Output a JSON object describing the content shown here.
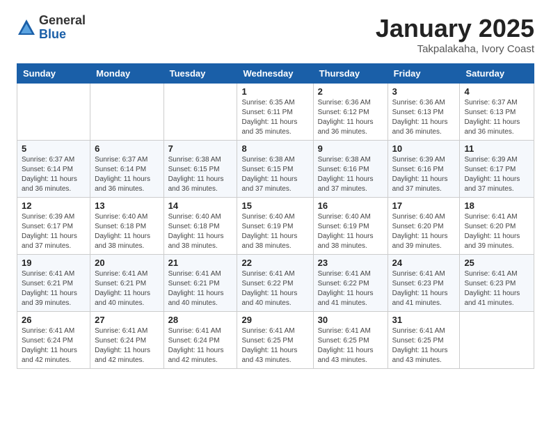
{
  "logo": {
    "general": "General",
    "blue": "Blue"
  },
  "title": "January 2025",
  "location": "Takpalakaha, Ivory Coast",
  "weekdays": [
    "Sunday",
    "Monday",
    "Tuesday",
    "Wednesday",
    "Thursday",
    "Friday",
    "Saturday"
  ],
  "weeks": [
    [
      {
        "day": "",
        "info": ""
      },
      {
        "day": "",
        "info": ""
      },
      {
        "day": "",
        "info": ""
      },
      {
        "day": "1",
        "info": "Sunrise: 6:35 AM\nSunset: 6:11 PM\nDaylight: 11 hours\nand 35 minutes."
      },
      {
        "day": "2",
        "info": "Sunrise: 6:36 AM\nSunset: 6:12 PM\nDaylight: 11 hours\nand 36 minutes."
      },
      {
        "day": "3",
        "info": "Sunrise: 6:36 AM\nSunset: 6:13 PM\nDaylight: 11 hours\nand 36 minutes."
      },
      {
        "day": "4",
        "info": "Sunrise: 6:37 AM\nSunset: 6:13 PM\nDaylight: 11 hours\nand 36 minutes."
      }
    ],
    [
      {
        "day": "5",
        "info": "Sunrise: 6:37 AM\nSunset: 6:14 PM\nDaylight: 11 hours\nand 36 minutes."
      },
      {
        "day": "6",
        "info": "Sunrise: 6:37 AM\nSunset: 6:14 PM\nDaylight: 11 hours\nand 36 minutes."
      },
      {
        "day": "7",
        "info": "Sunrise: 6:38 AM\nSunset: 6:15 PM\nDaylight: 11 hours\nand 36 minutes."
      },
      {
        "day": "8",
        "info": "Sunrise: 6:38 AM\nSunset: 6:15 PM\nDaylight: 11 hours\nand 37 minutes."
      },
      {
        "day": "9",
        "info": "Sunrise: 6:38 AM\nSunset: 6:16 PM\nDaylight: 11 hours\nand 37 minutes."
      },
      {
        "day": "10",
        "info": "Sunrise: 6:39 AM\nSunset: 6:16 PM\nDaylight: 11 hours\nand 37 minutes."
      },
      {
        "day": "11",
        "info": "Sunrise: 6:39 AM\nSunset: 6:17 PM\nDaylight: 11 hours\nand 37 minutes."
      }
    ],
    [
      {
        "day": "12",
        "info": "Sunrise: 6:39 AM\nSunset: 6:17 PM\nDaylight: 11 hours\nand 37 minutes."
      },
      {
        "day": "13",
        "info": "Sunrise: 6:40 AM\nSunset: 6:18 PM\nDaylight: 11 hours\nand 38 minutes."
      },
      {
        "day": "14",
        "info": "Sunrise: 6:40 AM\nSunset: 6:18 PM\nDaylight: 11 hours\nand 38 minutes."
      },
      {
        "day": "15",
        "info": "Sunrise: 6:40 AM\nSunset: 6:19 PM\nDaylight: 11 hours\nand 38 minutes."
      },
      {
        "day": "16",
        "info": "Sunrise: 6:40 AM\nSunset: 6:19 PM\nDaylight: 11 hours\nand 38 minutes."
      },
      {
        "day": "17",
        "info": "Sunrise: 6:40 AM\nSunset: 6:20 PM\nDaylight: 11 hours\nand 39 minutes."
      },
      {
        "day": "18",
        "info": "Sunrise: 6:41 AM\nSunset: 6:20 PM\nDaylight: 11 hours\nand 39 minutes."
      }
    ],
    [
      {
        "day": "19",
        "info": "Sunrise: 6:41 AM\nSunset: 6:21 PM\nDaylight: 11 hours\nand 39 minutes."
      },
      {
        "day": "20",
        "info": "Sunrise: 6:41 AM\nSunset: 6:21 PM\nDaylight: 11 hours\nand 40 minutes."
      },
      {
        "day": "21",
        "info": "Sunrise: 6:41 AM\nSunset: 6:21 PM\nDaylight: 11 hours\nand 40 minutes."
      },
      {
        "day": "22",
        "info": "Sunrise: 6:41 AM\nSunset: 6:22 PM\nDaylight: 11 hours\nand 40 minutes."
      },
      {
        "day": "23",
        "info": "Sunrise: 6:41 AM\nSunset: 6:22 PM\nDaylight: 11 hours\nand 41 minutes."
      },
      {
        "day": "24",
        "info": "Sunrise: 6:41 AM\nSunset: 6:23 PM\nDaylight: 11 hours\nand 41 minutes."
      },
      {
        "day": "25",
        "info": "Sunrise: 6:41 AM\nSunset: 6:23 PM\nDaylight: 11 hours\nand 41 minutes."
      }
    ],
    [
      {
        "day": "26",
        "info": "Sunrise: 6:41 AM\nSunset: 6:24 PM\nDaylight: 11 hours\nand 42 minutes."
      },
      {
        "day": "27",
        "info": "Sunrise: 6:41 AM\nSunset: 6:24 PM\nDaylight: 11 hours\nand 42 minutes."
      },
      {
        "day": "28",
        "info": "Sunrise: 6:41 AM\nSunset: 6:24 PM\nDaylight: 11 hours\nand 42 minutes."
      },
      {
        "day": "29",
        "info": "Sunrise: 6:41 AM\nSunset: 6:25 PM\nDaylight: 11 hours\nand 43 minutes."
      },
      {
        "day": "30",
        "info": "Sunrise: 6:41 AM\nSunset: 6:25 PM\nDaylight: 11 hours\nand 43 minutes."
      },
      {
        "day": "31",
        "info": "Sunrise: 6:41 AM\nSunset: 6:25 PM\nDaylight: 11 hours\nand 43 minutes."
      },
      {
        "day": "",
        "info": ""
      }
    ]
  ]
}
